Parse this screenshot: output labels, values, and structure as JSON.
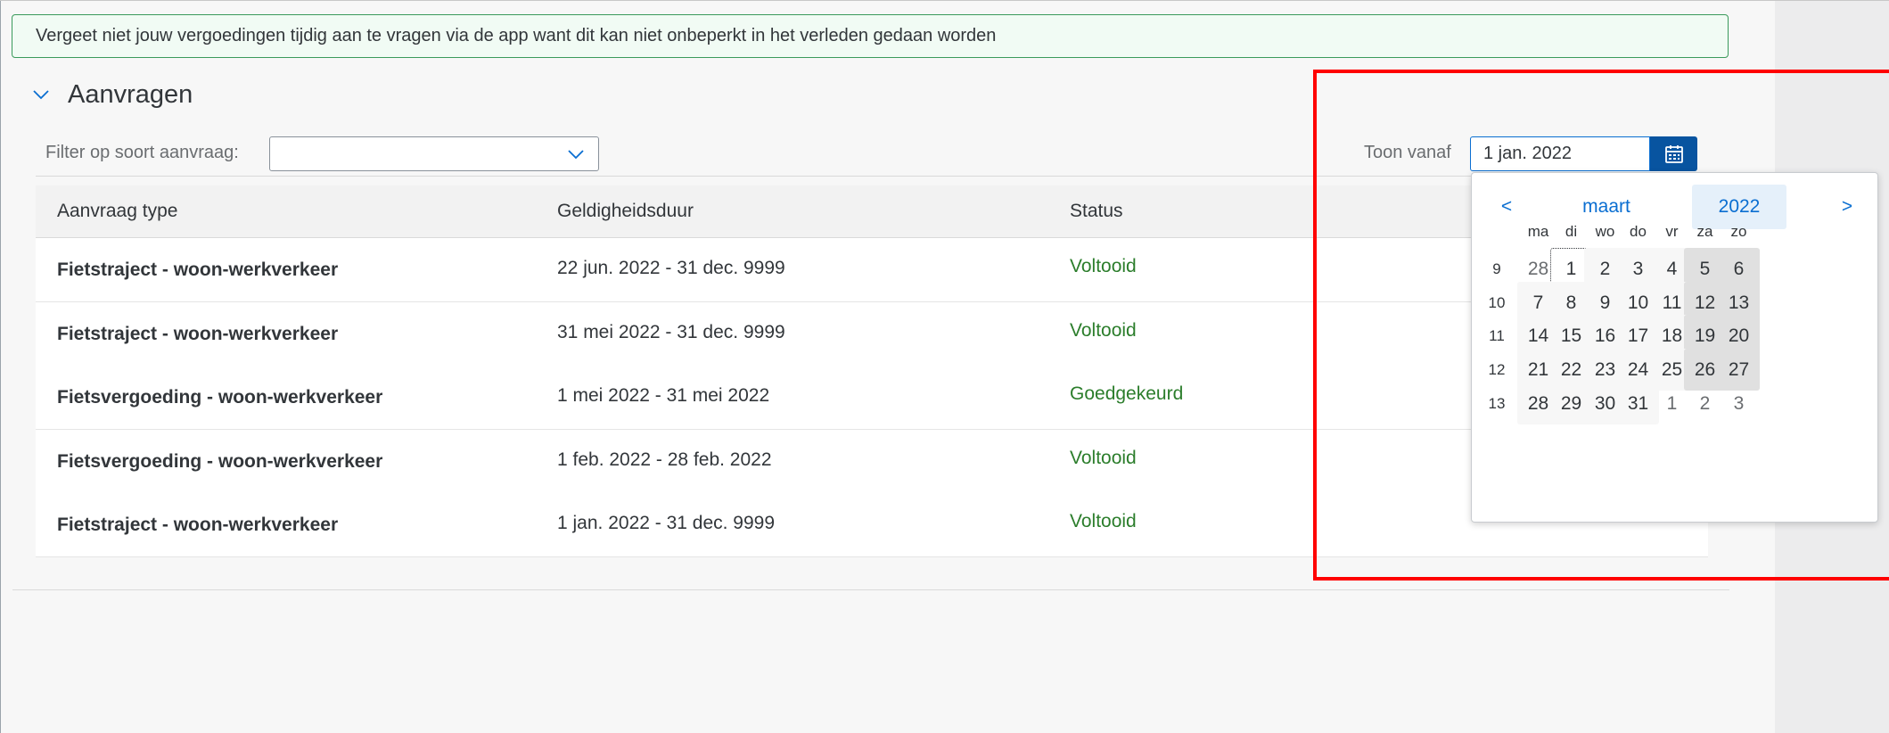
{
  "notice": {
    "text": "Vergeet niet jouw vergoedingen tijdig aan te vragen via de app want dit kan niet onbeperkt in het verleden gedaan worden"
  },
  "section": {
    "title": "Aanvragen"
  },
  "filter": {
    "label": "Filter op soort aanvraag:",
    "value": ""
  },
  "toon_vanaf": {
    "label": "Toon vanaf",
    "value": "1 jan. 2022"
  },
  "table": {
    "headers": [
      "Aanvraag type",
      "Geldigheidsduur",
      "Status"
    ],
    "rows": [
      {
        "type": "Fietstraject - woon-werkverkeer",
        "period": "22 jun. 2022 - 31 dec. 9999",
        "status": "Voltooid"
      },
      {
        "type": "Fietstraject - woon-werkverkeer",
        "period": "31 mei 2022 - 31 dec. 9999",
        "status": "Voltooid"
      },
      {
        "type": "Fietsvergoeding - woon-werkverkeer",
        "period": "1 mei 2022 - 31 mei 2022",
        "status": "Goedgekeurd"
      },
      {
        "type": "Fietsvergoeding - woon-werkverkeer",
        "period": "1 feb. 2022 - 28 feb. 2022",
        "status": "Voltooid"
      },
      {
        "type": "Fietstraject - woon-werkverkeer",
        "period": "1 jan. 2022 - 31 dec. 9999",
        "status": "Voltooid"
      }
    ]
  },
  "calendar": {
    "prev": "<",
    "next": ">",
    "month": "maart",
    "year": "2022",
    "weekdays": [
      "ma",
      "di",
      "wo",
      "do",
      "vr",
      "za",
      "zo"
    ],
    "weeks": [
      {
        "week": "9",
        "days": [
          "28",
          "1",
          "2",
          "3",
          "4",
          "5",
          "6"
        ]
      },
      {
        "week": "10",
        "days": [
          "7",
          "8",
          "9",
          "10",
          "11",
          "12",
          "13"
        ]
      },
      {
        "week": "11",
        "days": [
          "14",
          "15",
          "16",
          "17",
          "18",
          "19",
          "20"
        ]
      },
      {
        "week": "12",
        "days": [
          "21",
          "22",
          "23",
          "24",
          "25",
          "26",
          "27"
        ]
      },
      {
        "week": "13",
        "days": [
          "28",
          "29",
          "30",
          "31",
          "1",
          "2",
          "3"
        ]
      }
    ]
  },
  "colors": {
    "accent": "#0a6ed1",
    "status_green": "#2b7d2b",
    "highlight_red": "#ff0000"
  }
}
